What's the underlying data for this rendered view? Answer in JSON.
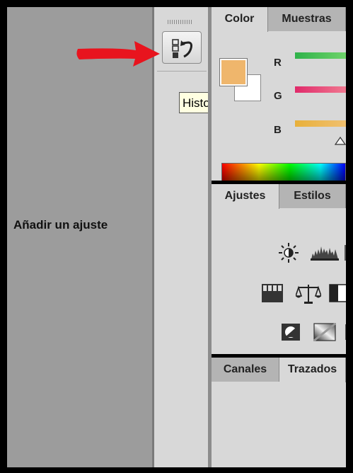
{
  "dock": {
    "history_button_icon": "history-icon",
    "tooltip": "Historia",
    "annotation_arrow_color": "#e8141e"
  },
  "color_panel": {
    "tabs": [
      "Color",
      "Muestras"
    ],
    "foreground_color": "#efb66c",
    "background_color": "#ffffff",
    "channels": [
      "R",
      "G",
      "B"
    ],
    "icons": [
      "foreground-swatch",
      "background-swatch",
      "spectrum-ramp"
    ]
  },
  "adjustments_panel": {
    "tabs": [
      "Ajustes",
      "Estilos"
    ],
    "title": "Añadir un ajuste",
    "icons": [
      "brightness-contrast-icon",
      "levels-icon",
      "curves-icon",
      "color-balance-icon",
      "black-white-icon",
      "invert-icon",
      "gradient-map-icon"
    ]
  },
  "layers_panel": {
    "tabs": [
      "Canales",
      "Trazados"
    ]
  }
}
